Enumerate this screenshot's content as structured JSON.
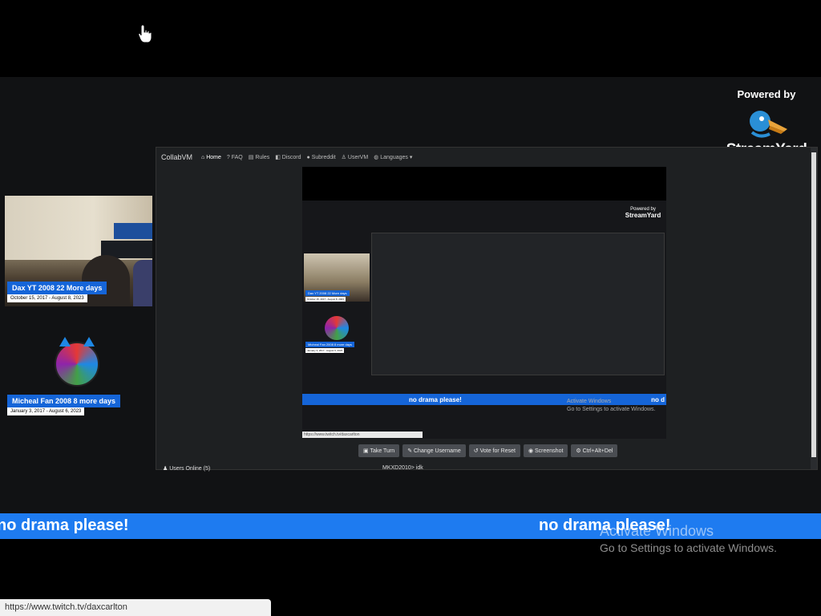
{
  "stream": {
    "powered_by": "Powered by",
    "brand": "StreamYard"
  },
  "participants": [
    {
      "name": "Dax YT 2008 22 More days",
      "dates": "October 15, 2017 - August 8, 2023"
    },
    {
      "name": "Micheal Fan 2008 8 more days",
      "dates": "January 3, 2017 - August 6, 2023"
    }
  ],
  "collabvm": {
    "brand": "CollabVM",
    "nav": [
      "Home",
      "FAQ",
      "Rules",
      "Discord",
      "Subreddit",
      "UserVM",
      "Languages"
    ],
    "inner_banner": "no drama please!",
    "inner_banner_right": "no d",
    "inner_activate_1": "Activate Windows",
    "inner_activate_2": "Go to Settings to activate Windows.",
    "inner_url": "https://www.twitch.tv/daxcarlton",
    "buttons": [
      "Take Turn",
      "Change Username",
      "Vote for Reset",
      "Screenshot",
      "Ctrl+Alt+Del"
    ],
    "users_online": "Users Online (5)",
    "chat_line": "MKXD2010> idk"
  },
  "ticker": {
    "left_text": "no drama please!",
    "right_text": "no drama please!"
  },
  "windows_watermark": {
    "line1": "Activate Windows",
    "line2": "Go to Settings to activate Windows."
  },
  "status_bar": {
    "url": "https://www.twitch.tv/daxcarlton"
  },
  "colors": {
    "accent_blue": "#1e7bf0",
    "label_blue": "#1565d8",
    "background": "#111214"
  }
}
